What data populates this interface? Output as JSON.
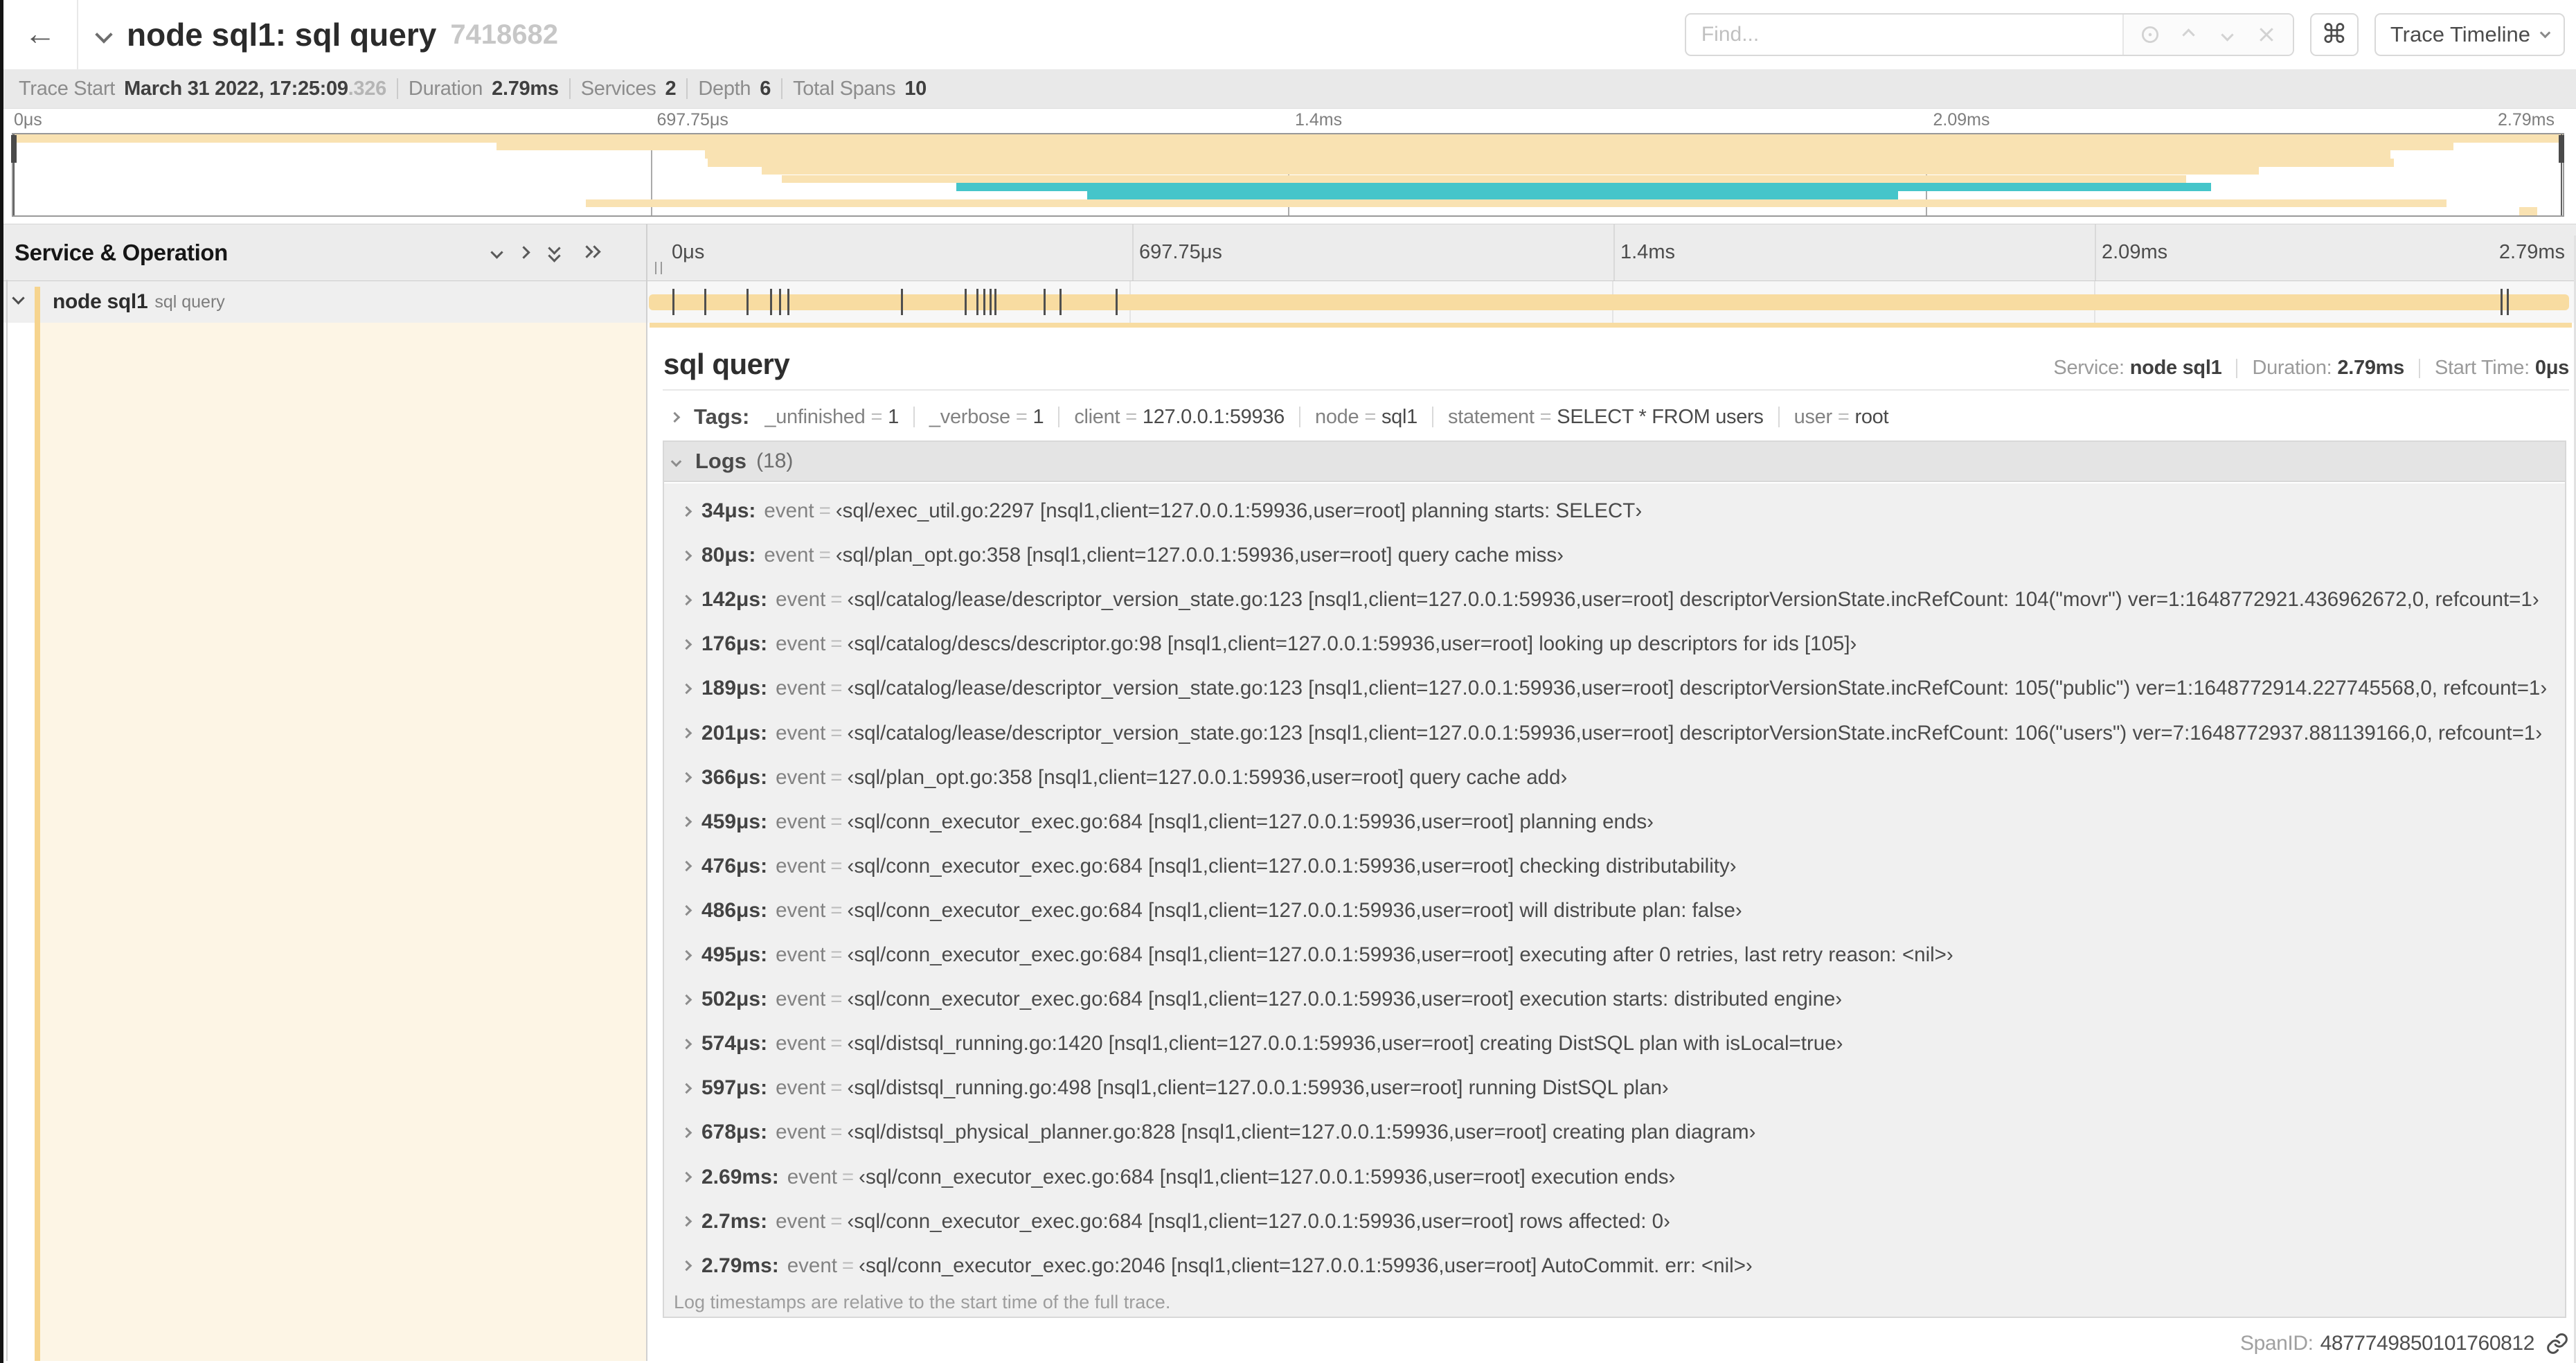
{
  "header": {
    "back_label": "←",
    "title": "node sql1: sql query",
    "trace_id": "7418682",
    "find_placeholder": "Find...",
    "cmd_glyph": "⌘",
    "view_dropdown_label": "Trace Timeline"
  },
  "stats": {
    "items": [
      {
        "label": "Trace Start",
        "value": "March 31 2022, 17:25:09",
        "muted": ".326"
      },
      {
        "label": "Duration",
        "value": "2.79ms"
      },
      {
        "label": "Services",
        "value": "2"
      },
      {
        "label": "Depth",
        "value": "6"
      },
      {
        "label": "Total Spans",
        "value": "10"
      }
    ]
  },
  "colors": {
    "tan": "#f8dca1",
    "teal": "#17b8be",
    "minimap_tan": "#f9e2b2",
    "minimap_teal": "#45c5ca"
  },
  "chart_data": {
    "type": "gantt-minimap",
    "title": "trace span overview",
    "time_ticks": [
      {
        "label": "0μs",
        "pos": 0
      },
      {
        "label": "697.75μs",
        "pos": 0.25
      },
      {
        "label": "1.4ms",
        "pos": 0.5
      },
      {
        "label": "2.09ms",
        "pos": 0.75
      },
      {
        "label": "2.79ms",
        "pos": 1
      }
    ],
    "xlim_us": [
      0,
      2790
    ],
    "spans": [
      {
        "row": 0,
        "start": 0.0,
        "end": 1.0,
        "color": "minimap_tan"
      },
      {
        "row": 1,
        "start": 0.1897,
        "end": 0.9571,
        "color": "minimap_tan"
      },
      {
        "row": 2,
        "start": 0.2712,
        "end": 0.9324,
        "color": "minimap_tan"
      },
      {
        "row": 3,
        "start": 0.2723,
        "end": 0.9337,
        "color": "minimap_tan"
      },
      {
        "row": 4,
        "start": 0.2935,
        "end": 0.8807,
        "color": "minimap_tan"
      },
      {
        "row": 5,
        "start": 0.3016,
        "end": 0.8522,
        "color": "minimap_tan"
      },
      {
        "row": 6,
        "start": 0.3698,
        "end": 0.862,
        "color": "minimap_teal"
      },
      {
        "row": 7,
        "start": 0.4212,
        "end": 0.7394,
        "color": "minimap_teal"
      },
      {
        "row": 8,
        "start": 0.2245,
        "end": 0.9543,
        "color": "minimap_tan"
      },
      {
        "row": 9,
        "start": 0.9829,
        "end": 0.9899,
        "color": "minimap_tan"
      }
    ]
  },
  "timeline": {
    "header_title": "Service & Operation",
    "row": {
      "service": "node sql1",
      "operation": "sql query",
      "bar_color": "#f8dca1",
      "log_tick_fractions": [
        0.0122,
        0.0287,
        0.0509,
        0.0631,
        0.0677,
        0.072,
        0.1312,
        0.1645,
        0.1706,
        0.1742,
        0.1774,
        0.1799,
        0.2057,
        0.214,
        0.243,
        0.9642,
        0.9677
      ]
    }
  },
  "detail": {
    "title": "sql query",
    "info": [
      {
        "label": "Service:",
        "value": "node sql1"
      },
      {
        "label": "Duration:",
        "value": "2.79ms"
      },
      {
        "label": "Start Time:",
        "value": "0μs"
      }
    ],
    "tags_label": "Tags:",
    "tags": [
      {
        "key": "_unfinished",
        "value": "1"
      },
      {
        "key": "_verbose",
        "value": "1"
      },
      {
        "key": "client",
        "value": "127.0.0.1:59936"
      },
      {
        "key": "node",
        "value": "sql1"
      },
      {
        "key": "statement",
        "value": "SELECT * FROM users"
      },
      {
        "key": "user",
        "value": "root"
      }
    ],
    "logs_label": "Logs",
    "logs_count": "(18)",
    "logs_key": "event",
    "logs": [
      {
        "t": "34μs:",
        "value": "‹sql/exec_util.go:2297 [nsql1,client=127.0.0.1:59936,user=root] planning starts: SELECT›"
      },
      {
        "t": "80μs:",
        "value": "‹sql/plan_opt.go:358 [nsql1,client=127.0.0.1:59936,user=root] query cache miss›"
      },
      {
        "t": "142μs:",
        "value": "‹sql/catalog/lease/descriptor_version_state.go:123 [nsql1,client=127.0.0.1:59936,user=root] descriptorVersionState.incRefCount: 104(\"movr\") ver=1:1648772921.436962672,0, refcount=1›"
      },
      {
        "t": "176μs:",
        "value": "‹sql/catalog/descs/descriptor.go:98 [nsql1,client=127.0.0.1:59936,user=root] looking up descriptors for ids [105]›"
      },
      {
        "t": "189μs:",
        "value": "‹sql/catalog/lease/descriptor_version_state.go:123 [nsql1,client=127.0.0.1:59936,user=root] descriptorVersionState.incRefCount: 105(\"public\") ver=1:1648772914.227745568,0, refcount=1›"
      },
      {
        "t": "201μs:",
        "value": "‹sql/catalog/lease/descriptor_version_state.go:123 [nsql1,client=127.0.0.1:59936,user=root] descriptorVersionState.incRefCount: 106(\"users\") ver=7:1648772937.881139166,0, refcount=1›"
      },
      {
        "t": "366μs:",
        "value": "‹sql/plan_opt.go:358 [nsql1,client=127.0.0.1:59936,user=root] query cache add›"
      },
      {
        "t": "459μs:",
        "value": "‹sql/conn_executor_exec.go:684 [nsql1,client=127.0.0.1:59936,user=root] planning ends›"
      },
      {
        "t": "476μs:",
        "value": "‹sql/conn_executor_exec.go:684 [nsql1,client=127.0.0.1:59936,user=root] checking distributability›"
      },
      {
        "t": "486μs:",
        "value": "‹sql/conn_executor_exec.go:684 [nsql1,client=127.0.0.1:59936,user=root] will distribute plan: false›"
      },
      {
        "t": "495μs:",
        "value": "‹sql/conn_executor_exec.go:684 [nsql1,client=127.0.0.1:59936,user=root] executing after 0 retries, last retry reason: <nil>›"
      },
      {
        "t": "502μs:",
        "value": "‹sql/conn_executor_exec.go:684 [nsql1,client=127.0.0.1:59936,user=root] execution starts: distributed engine›"
      },
      {
        "t": "574μs:",
        "value": "‹sql/distsql_running.go:1420 [nsql1,client=127.0.0.1:59936,user=root] creating DistSQL plan with isLocal=true›"
      },
      {
        "t": "597μs:",
        "value": "‹sql/distsql_running.go:498 [nsql1,client=127.0.0.1:59936,user=root] running DistSQL plan›"
      },
      {
        "t": "678μs:",
        "value": "‹sql/distsql_physical_planner.go:828 [nsql1,client=127.0.0.1:59936,user=root] creating plan diagram›"
      },
      {
        "t": "2.69ms:",
        "value": "‹sql/conn_executor_exec.go:684 [nsql1,client=127.0.0.1:59936,user=root] execution ends›"
      },
      {
        "t": "2.7ms:",
        "value": "‹sql/conn_executor_exec.go:684 [nsql1,client=127.0.0.1:59936,user=root] rows affected: 0›"
      },
      {
        "t": "2.79ms:",
        "value": "‹sql/conn_executor_exec.go:2046 [nsql1,client=127.0.0.1:59936,user=root] AutoCommit. err: <nil>›"
      }
    ],
    "logs_note": "Log timestamps are relative to the start time of the full trace.",
    "spanid_label": "SpanID:",
    "spanid_value": "4877749850101760812"
  }
}
